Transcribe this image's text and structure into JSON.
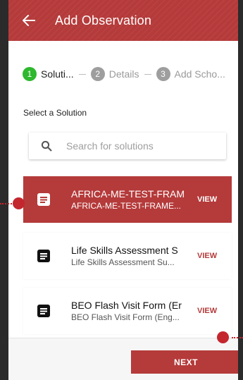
{
  "header": {
    "title": "Add Observation"
  },
  "stepper": {
    "steps": [
      {
        "number": "1",
        "label": "Soluti..."
      },
      {
        "number": "2",
        "label": "Details"
      },
      {
        "number": "3",
        "label": "Add Scho..."
      }
    ]
  },
  "select_label": "Select a Solution",
  "search": {
    "placeholder": "Search for solutions",
    "value": ""
  },
  "solutions": [
    {
      "title": "AFRICA-ME-TEST-FRAM",
      "subtitle": "AFRICA-ME-TEST-FRAME...",
      "action": "VIEW",
      "selected": true
    },
    {
      "title": "Life Skills Assessment S",
      "subtitle": "Life Skills Assessment Su...",
      "action": "VIEW",
      "selected": false
    },
    {
      "title": "BEO Flash Visit Form (Er",
      "subtitle": "BEO Flash Visit Form (Eng...",
      "action": "VIEW",
      "selected": false
    }
  ],
  "footer": {
    "next_label": "NEXT"
  },
  "colors": {
    "accent": "#b53a3a",
    "active_step": "#2eb82e",
    "hotspot": "#c4262e"
  }
}
